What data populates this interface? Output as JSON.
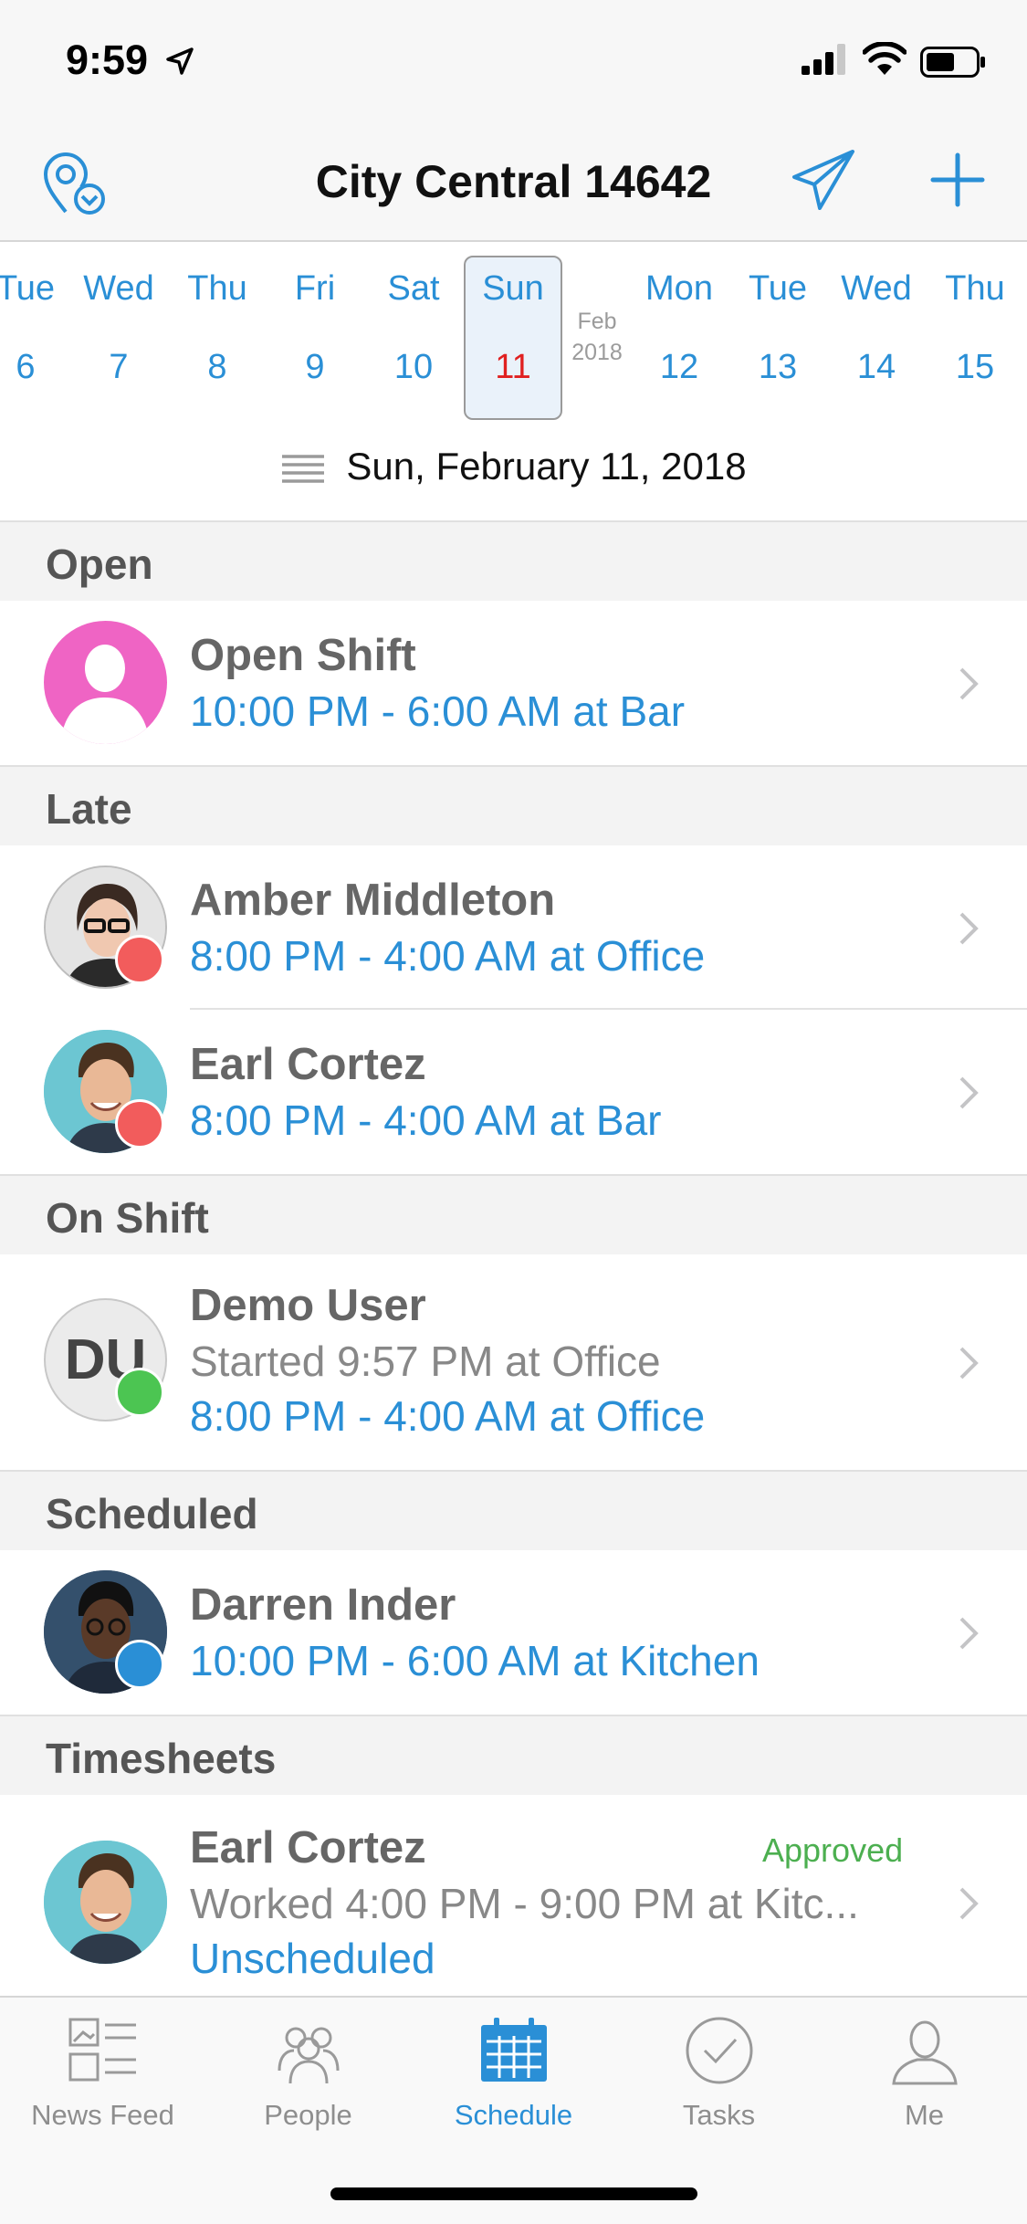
{
  "status_bar": {
    "time": "9:59"
  },
  "nav": {
    "title": "City Central 14642"
  },
  "calendar": {
    "days": [
      {
        "dow": "Tue",
        "num": "6"
      },
      {
        "dow": "Wed",
        "num": "7"
      },
      {
        "dow": "Thu",
        "num": "8"
      },
      {
        "dow": "Fri",
        "num": "9"
      },
      {
        "dow": "Sat",
        "num": "10"
      },
      {
        "dow": "Sun",
        "num": "11"
      },
      {
        "dow": "Mon",
        "num": "12"
      },
      {
        "dow": "Tue",
        "num": "13"
      },
      {
        "dow": "Wed",
        "num": "14"
      },
      {
        "dow": "Thu",
        "num": "15"
      }
    ],
    "month": "Feb",
    "year": "2018",
    "selected_date": "Sun, February 11, 2018"
  },
  "sections": {
    "open": {
      "heading": "Open",
      "rows": [
        {
          "name": "Open Shift",
          "shift": "10:00 PM - 6:00 AM at Bar"
        }
      ]
    },
    "late": {
      "heading": "Late",
      "rows": [
        {
          "name": "Amber Middleton",
          "shift": "8:00 PM - 4:00 AM at Office"
        },
        {
          "name": "Earl Cortez",
          "shift": "8:00 PM - 4:00 AM at Bar"
        }
      ]
    },
    "on_shift": {
      "heading": "On Shift",
      "rows": [
        {
          "initials": "DU",
          "name": "Demo User",
          "started": "Started 9:57 PM at Office",
          "shift": "8:00 PM - 4:00 AM at Office"
        }
      ]
    },
    "scheduled": {
      "heading": "Scheduled",
      "rows": [
        {
          "name": "Darren Inder",
          "shift": "10:00 PM - 6:00 AM at Kitchen"
        }
      ]
    },
    "timesheets": {
      "heading": "Timesheets",
      "rows": [
        {
          "name": "Earl Cortez",
          "status": "Approved",
          "worked": "Worked 4:00 PM - 9:00 PM at Kitc...",
          "note": "Unscheduled"
        }
      ]
    }
  },
  "tabs": [
    {
      "label": "News Feed",
      "icon": "news-feed-icon"
    },
    {
      "label": "People",
      "icon": "people-icon"
    },
    {
      "label": "Schedule",
      "icon": "calendar-icon"
    },
    {
      "label": "Tasks",
      "icon": "check-circle-icon"
    },
    {
      "label": "Me",
      "icon": "person-icon"
    }
  ],
  "colors": {
    "accent": "#2a8fd6",
    "late_dot": "#f25c5c",
    "on_shift_dot": "#4cc552",
    "scheduled_dot": "#2a8fd6",
    "open_avatar": "#ef64c4",
    "approved": "#4caf50",
    "selected_day": "#e02020"
  }
}
